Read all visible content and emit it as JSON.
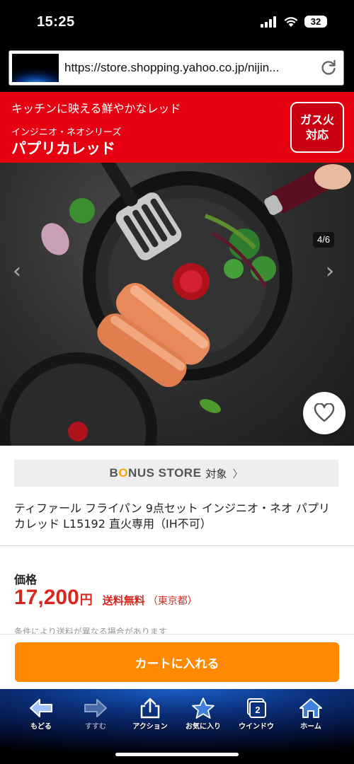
{
  "status_bar": {
    "time": "15:25",
    "battery": "32",
    "icons": [
      "signal-icon",
      "wifi-icon",
      "battery-icon"
    ]
  },
  "address_bar": {
    "url": "https://store.shopping.yahoo.co.jp/nijin..."
  },
  "product_image": {
    "banner": {
      "line1": "キッチンに映える鮮やかなレッド",
      "line2": "インジニオ・ネオシリーズ",
      "line3": "パプリカレッド",
      "color": "#e60012"
    },
    "gas_badge": {
      "line1": "ガス火",
      "line2": "対応"
    },
    "counter": "4/6"
  },
  "bonus": {
    "brand_pre": "B",
    "brand_o": "O",
    "brand_post": "NUS STORE",
    "suffix": "対象",
    "chevron": "〉"
  },
  "product": {
    "title": "ティファール フライパン 9点セット インジニオ・ネオ パプリカレッド L15192 直火専用（IH不可）"
  },
  "price": {
    "label": "価格",
    "value": "17,200",
    "unit": "円",
    "shipping": "送料無料",
    "region": "（東京都）",
    "note": "条件により送料が異なる場合があります",
    "color": "#d9261c"
  },
  "cart": {
    "label": "カートに入れる",
    "color": "#ff8a00"
  },
  "toolbar": {
    "back": "もどる",
    "forward": "すすむ",
    "action": "アクション",
    "bookmarks": "お気に入り",
    "windows": "ウインドウ",
    "windows_count": "2",
    "home": "ホーム"
  }
}
